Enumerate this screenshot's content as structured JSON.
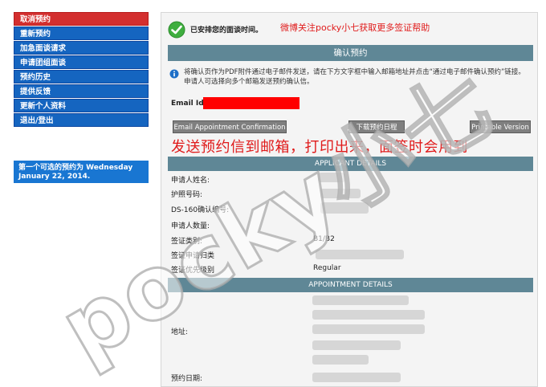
{
  "sidebar": {
    "items": [
      {
        "label": "取消预约",
        "active": true
      },
      {
        "label": "重新预约",
        "active": false
      },
      {
        "label": "加急面谈请求",
        "active": false
      },
      {
        "label": "申请团组面谈",
        "active": false
      },
      {
        "label": "预约历史",
        "active": false
      },
      {
        "label": "提供反馈",
        "active": false
      },
      {
        "label": "更新个人资料",
        "active": false
      },
      {
        "label": "退出/登出",
        "active": false
      }
    ],
    "first_available": "第一个可选的预约为 Wednesday January 22, 2014."
  },
  "status": {
    "icon": "check-circle-icon",
    "text": "已安排您的面谈时间。",
    "promo": "微博关注pocky小七获取更多签证帮助"
  },
  "confirm_section": {
    "header": "确认预约",
    "info_icon": "info-icon",
    "info_text": "将确认页作为PDF附件通过电子邮件发送，请在下方文字框中输入邮箱地址并点击“通过电子邮件确认预约”链接。申请人可选择向多个邮箱发送预约确认信。",
    "email_label": "Email Id:",
    "buttons": {
      "email": "Email Appointment Confirmation",
      "download": "下载预约日程",
      "print": "Printable Version"
    },
    "annotation": "发送预约信到邮箱，打印出来，面签时会用到"
  },
  "applicant": {
    "header": "APPLICANT DETAILS",
    "rows": [
      {
        "label": "申请人姓名:",
        "value": ""
      },
      {
        "label": "护照号码:",
        "value": ""
      },
      {
        "label": "DS-160确认编号:",
        "value": ""
      },
      {
        "label": "申请人数量:",
        "value": ""
      },
      {
        "label": "签证类别:",
        "value": "B1/B2"
      },
      {
        "label": "签证申请归类",
        "value": ""
      },
      {
        "label": "签证优先级别",
        "value": "Regular"
      }
    ]
  },
  "appointment": {
    "header": "APPOINTMENT DETAILS",
    "address_label": "地址:",
    "date_label": "预约日期:"
  },
  "watermark": "pocky小七",
  "colors": {
    "nav_blue": "#1565c0",
    "nav_active_red": "#d32f2f",
    "section_header": "#5f8796",
    "annotation_red": "#e01b1b"
  }
}
